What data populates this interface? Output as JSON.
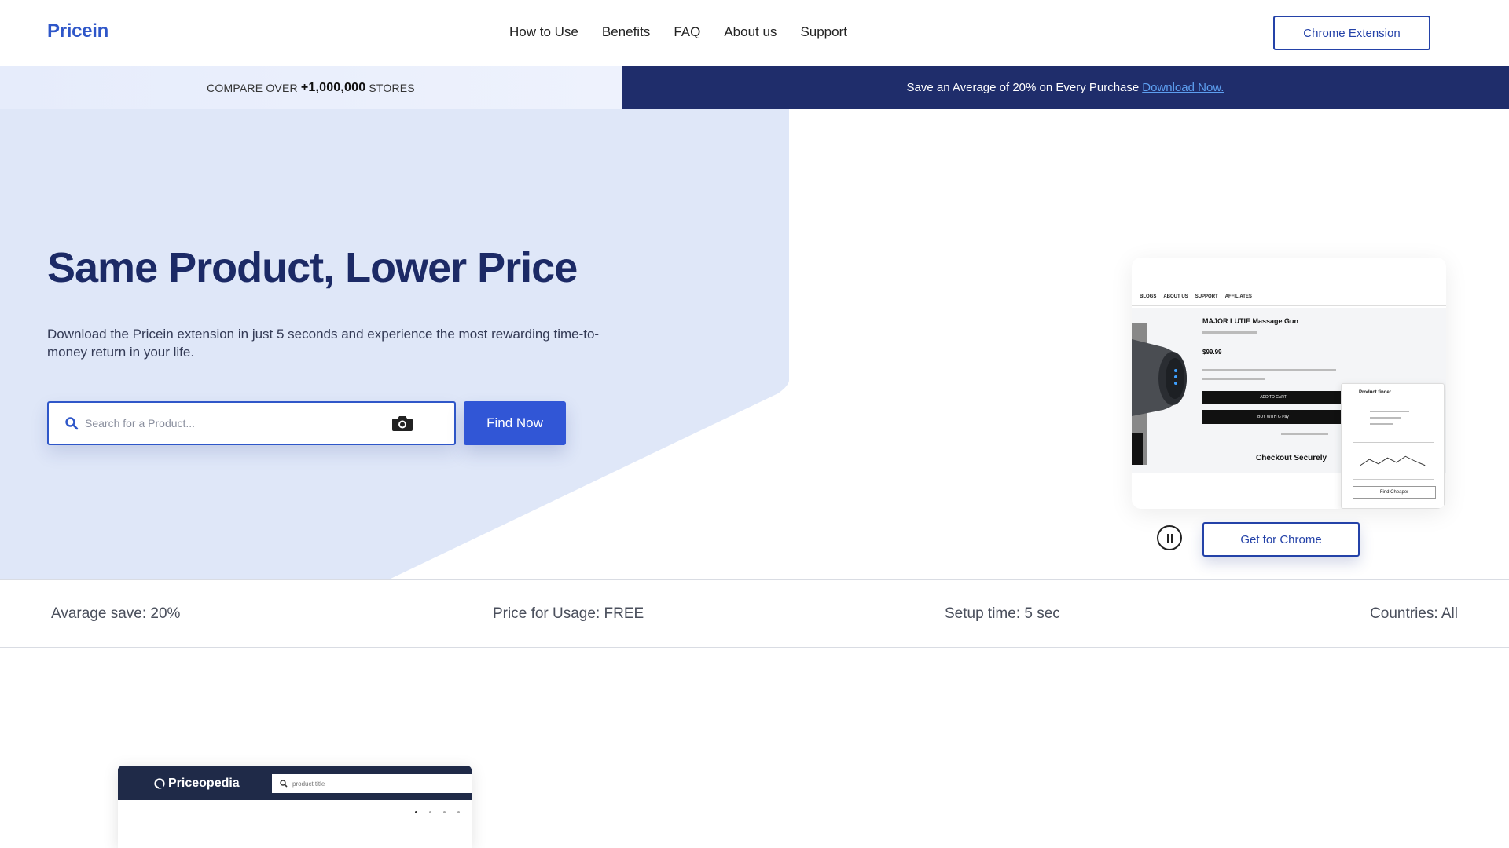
{
  "header": {
    "logo": "Pricein",
    "nav": [
      "How to Use",
      "Benefits",
      "FAQ",
      "About us",
      "Support"
    ],
    "cta": "Chrome Extension"
  },
  "banner": {
    "left_prefix": "COMPARE OVER",
    "left_count": "+1,000,000",
    "left_suffix": "STORES",
    "right_text": "Save an Average of 20% on Every Purchase",
    "right_link": "Download Now."
  },
  "hero": {
    "title": "Same Product, Lower Price",
    "subtitle": "Download the Pricein extension in just 5 seconds and experience the most rewarding time-to-money return in your life.",
    "search_placeholder": "Search for a Product...",
    "find_button": "Find Now",
    "get_chrome_button": "Get for Chrome"
  },
  "demo": {
    "nav": [
      "BLOGS",
      "ABOUT US",
      "SUPPORT",
      "AFFILIATES"
    ],
    "product_title": "MAJOR LUTIE Massage Gun",
    "price": "$99.99",
    "add_to_cart": "ADD TO CART",
    "buy_with": "BUY WITH G Pay",
    "checkout": "Checkout Securely",
    "popup_title": "Product finder",
    "popup_button": "Find Cheaper"
  },
  "stats": [
    "Avarage save: 20%",
    "Price for Usage: FREE",
    "Setup time: 5 sec",
    "Countries: All"
  ],
  "bottom_preview": {
    "logo": "Priceopedia",
    "search_placeholder": "product title"
  },
  "colors": {
    "brand_blue": "#2f57c9",
    "navy": "#1f2d6b",
    "hero_bg": "#dfe7f8"
  }
}
